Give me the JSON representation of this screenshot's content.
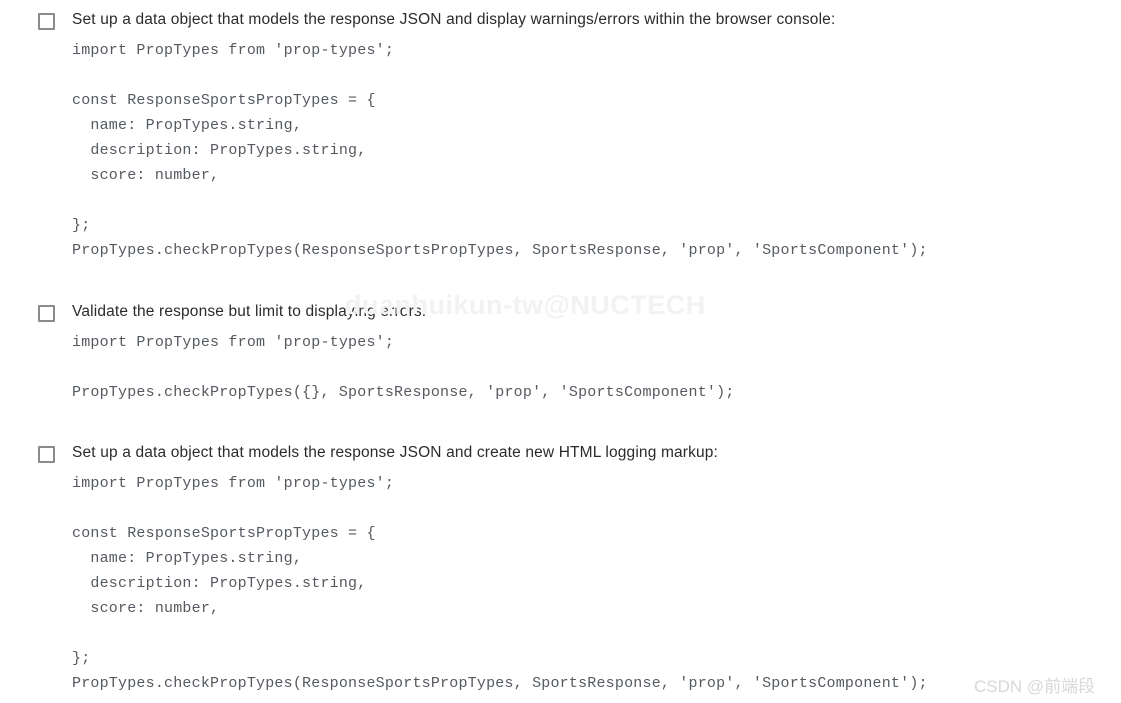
{
  "page": {
    "background_color": "#ffffff",
    "text_color": "#2b2b2b",
    "code_color": "#555a60",
    "checkbox_border_color": "#8b8b8b"
  },
  "options": [
    {
      "label": "Set up a data object that models the response JSON and display warnings/errors within the browser console:",
      "checked": false,
      "code": "import PropTypes from 'prop-types';\n\nconst ResponseSportsPropTypes = {\n  name: PropTypes.string,\n  description: PropTypes.string,\n  score: number,\n\n};\nPropTypes.checkPropTypes(ResponseSportsPropTypes, SportsResponse, 'prop', 'SportsComponent');"
    },
    {
      "label": "Validate the response but limit to displaying errors:",
      "checked": false,
      "code": "import PropTypes from 'prop-types';\n\nPropTypes.checkPropTypes({}, SportsResponse, 'prop', 'SportsComponent');"
    },
    {
      "label": "Set up a data object that models the response JSON and create new HTML logging markup:",
      "checked": false,
      "code": "import PropTypes from 'prop-types';\n\nconst ResponseSportsPropTypes = {\n  name: PropTypes.string,\n  description: PropTypes.string,\n  score: number,\n\n};\nPropTypes.checkPropTypes(ResponseSportsPropTypes, SportsResponse, 'prop', 'SportsComponent');"
    }
  ],
  "watermarks": {
    "center": "duanhuikun-tw@NUCTECH",
    "corner": "CSDN @前端段"
  }
}
